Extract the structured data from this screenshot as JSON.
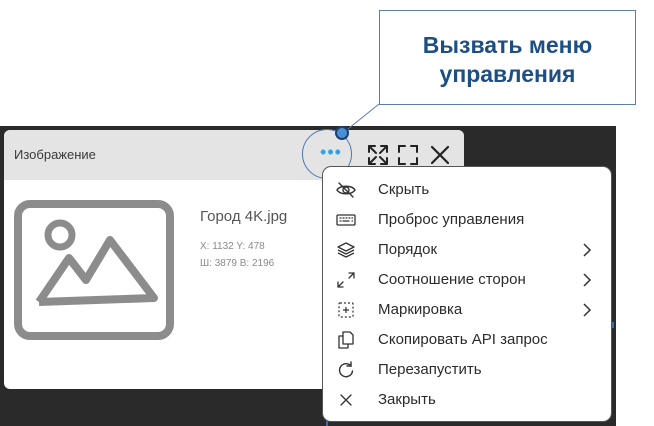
{
  "callout": {
    "line1": "Вызвать меню",
    "line2": "управления"
  },
  "card": {
    "title": "Изображение",
    "menu_button_glyph": "•••",
    "file_name": "Город 4K.jpg",
    "position_text": "X: 1132 Y: 478",
    "size_text": "Ш: 3879 В: 2196"
  },
  "icons": {
    "card_menu": "more-dots-icon",
    "expand": "expand-arrows-icon",
    "fullscreen": "fullscreen-icon",
    "close": "close-icon",
    "placeholder": "image-placeholder-icon"
  },
  "menu": {
    "items": [
      {
        "label": "Скрыть",
        "icon": "eye-off-icon",
        "submenu": false
      },
      {
        "label": "Проброс управления",
        "icon": "keyboard-icon",
        "submenu": false
      },
      {
        "label": "Порядок",
        "icon": "layers-icon",
        "submenu": true
      },
      {
        "label": "Соотношение сторон",
        "icon": "resize-diagonal-icon",
        "submenu": true
      },
      {
        "label": "Маркировка",
        "icon": "marker-grid-icon",
        "submenu": true
      },
      {
        "label": "Скопировать API запрос",
        "icon": "copy-icon",
        "submenu": false
      },
      {
        "label": "Перезапустить",
        "icon": "restart-icon",
        "submenu": false
      },
      {
        "label": "Закрыть",
        "icon": "close-icon",
        "submenu": false
      }
    ]
  },
  "colors": {
    "accent": "#2fa3e6",
    "callout_text": "#1d4f84",
    "stage_background": "#2a2a2a",
    "header_background": "#e4e4e4"
  }
}
